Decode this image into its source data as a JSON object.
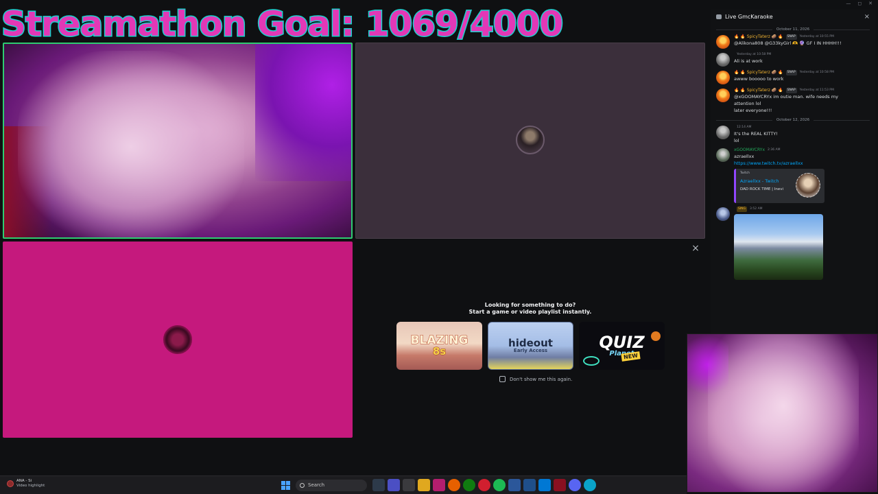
{
  "overlay": {
    "title": "Streamathon Goal: 1069/4000"
  },
  "video_tiles": [
    {
      "id": "cam1",
      "kind": "camera"
    },
    {
      "id": "avatar",
      "kind": "avatar"
    },
    {
      "id": "pink",
      "kind": "avatar",
      "avatar_text": ""
    }
  ],
  "activity": {
    "line1": "Looking for something to do?",
    "line2": "Start a game or video playlist instantly.",
    "close_glyph": "×",
    "cards": [
      {
        "name": "Blazing 8s",
        "title": "BLAZING",
        "sub": "8s"
      },
      {
        "name": "Hideout",
        "title": "hideout",
        "sub": "Early Access"
      },
      {
        "name": "Quiz Planet",
        "title": "QUIZ",
        "sub": "Planet",
        "badge": "NEW"
      }
    ],
    "dont_show": "Don't show me this again."
  },
  "chat": {
    "header": "Live GmcKaraoke",
    "close_glyph": "×",
    "dates": [
      "October 11, 2026",
      "October 12, 2026"
    ],
    "messages": [
      {
        "author": "🔥 🔥 SpicyTaterz 🥔 🔥",
        "tag": "SNAP",
        "time": "Yesterday at 10:55 PM",
        "lines": [
          "@Alikona808 @G33kyGirl 🫶 🔮 GF I IN HHHH!!!"
        ]
      },
      {
        "author": "",
        "tag": "",
        "time": "Yesterday at 10:58 PM",
        "lines": [
          "Ali is at work"
        ]
      },
      {
        "author": "🔥 🔥 SpicyTaterz 🥔 🔥",
        "tag": "SNAP",
        "time": "Yesterday at 10:58 PM",
        "lines": [
          "awww booooo to work"
        ]
      },
      {
        "author": "🔥 🔥 SpicyTaterz 🥔 🔥",
        "tag": "SNAP",
        "time": "Yesterday at 11:53 PM",
        "lines": [
          "@xGOOMAYCRYx im outie man. wife needs my",
          "attention lol",
          "later everyone!!!"
        ]
      },
      {
        "author": "",
        "tag": "",
        "time": "12:14 AM",
        "lines": [
          "It's the REAL KITTY!",
          "lol"
        ]
      },
      {
        "author": "xGOOMAYCRYx",
        "tag": "",
        "time": "2:36 AM",
        "lines": [
          "azraellxx",
          "https://www.twitch.tv/azraellxx"
        ]
      },
      {
        "author": "",
        "tag": "SING",
        "time": "3:52 AM",
        "lines": []
      }
    ],
    "embed": {
      "provider": "Twitch",
      "title": "Azraellxx - Twitch",
      "desc": "DAD ROCK TIME | Inevi"
    }
  },
  "window_controls": [
    "—",
    "◻",
    "✕"
  ],
  "taskbar": {
    "notif_line1": "ANA - Si",
    "notif_line2": "Video highlight",
    "search_label": "Search"
  },
  "colors": {
    "title_fill": "#e238b6",
    "title_stroke": "#19d4cf",
    "pink_tile": "#c5197d",
    "speaking_border": "#2ecc71"
  }
}
